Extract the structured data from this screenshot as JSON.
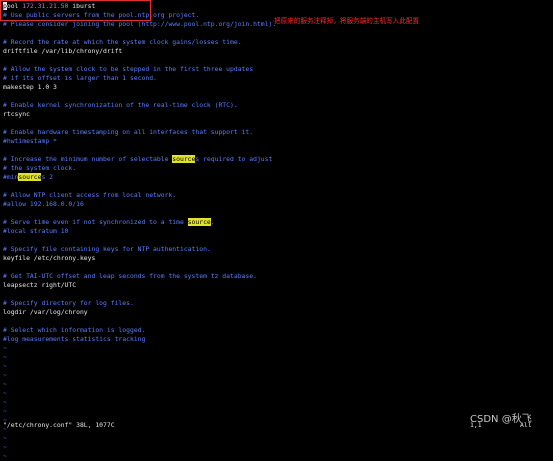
{
  "editor": {
    "lines": [
      {
        "kind": "pool",
        "cursor": "p",
        "rest": "ool ",
        "ip": "172.31.21.50",
        "tail": " iburst"
      },
      {
        "kind": "comment",
        "text": "# Use public servers from the pool.ntp.org project."
      },
      {
        "kind": "comment",
        "text": "# Please consider joining the pool (http://www.pool.ntp.org/join.html)."
      },
      {
        "kind": "blank"
      },
      {
        "kind": "comment",
        "text": "# Record the rate at which the system clock gains/losses time."
      },
      {
        "kind": "normal",
        "text": "driftfile /var/lib/chrony/drift"
      },
      {
        "kind": "blank"
      },
      {
        "kind": "comment",
        "text": "# Allow the system clock to be stepped in the first three updates"
      },
      {
        "kind": "comment",
        "text": "# if its offset is larger than 1 second."
      },
      {
        "kind": "normal",
        "text": "makestep 1.0 3"
      },
      {
        "kind": "blank"
      },
      {
        "kind": "comment",
        "text": "# Enable kernel synchronization of the real-time clock (RTC)."
      },
      {
        "kind": "normal",
        "text": "rtcsync"
      },
      {
        "kind": "blank"
      },
      {
        "kind": "comment",
        "text": "# Enable hardware timestamping on all interfaces that support it."
      },
      {
        "kind": "comment",
        "text": "#hwtimestamp *"
      },
      {
        "kind": "blank"
      },
      {
        "kind": "hlcomment",
        "before": "# Increase the minimum number of selectable ",
        "hl": "source",
        "after": "s required to adjust"
      },
      {
        "kind": "comment",
        "text": "# the system clock."
      },
      {
        "kind": "hlcomment",
        "before": "#min",
        "hl": "source",
        "after": "s 2"
      },
      {
        "kind": "blank"
      },
      {
        "kind": "comment",
        "text": "# Allow NTP client access from local network."
      },
      {
        "kind": "comment",
        "text": "#allow 192.168.0.0/16"
      },
      {
        "kind": "blank"
      },
      {
        "kind": "hlcomment",
        "before": "# Serve time even if not synchronized to a time ",
        "hl": "source",
        "after": "."
      },
      {
        "kind": "comment",
        "text": "#local stratum 10"
      },
      {
        "kind": "blank"
      },
      {
        "kind": "comment",
        "text": "# Specify file containing keys for NTP authentication."
      },
      {
        "kind": "normal",
        "text": "keyfile /etc/chrony.keys"
      },
      {
        "kind": "blank"
      },
      {
        "kind": "comment",
        "text": "# Get TAI-UTC offset and leap seconds from the system tz database."
      },
      {
        "kind": "normal",
        "text": "leapsectz right/UTC"
      },
      {
        "kind": "blank"
      },
      {
        "kind": "comment",
        "text": "# Specify directory for log files."
      },
      {
        "kind": "normal",
        "text": "logdir /var/log/chrony"
      },
      {
        "kind": "blank"
      },
      {
        "kind": "comment",
        "text": "# Select which information is logged."
      },
      {
        "kind": "comment",
        "text": "#log measurements statistics tracking"
      }
    ],
    "tilde": "~",
    "tilde_count": 13
  },
  "annotation": "把原来的服务注释掉，将服务端的主机写入此配置",
  "status": {
    "file_info": "\"/etc/chrony.conf\" 38L, 1077C",
    "ruler": "1,1          All"
  },
  "watermark": "CSDN @秋飞",
  "colors": {
    "background": "#000000",
    "comment": "#5c7dff",
    "text": "#e8e8e8",
    "highlight": "#e2e22c",
    "annotation": "#ff2a2a",
    "box": "#e03030"
  }
}
